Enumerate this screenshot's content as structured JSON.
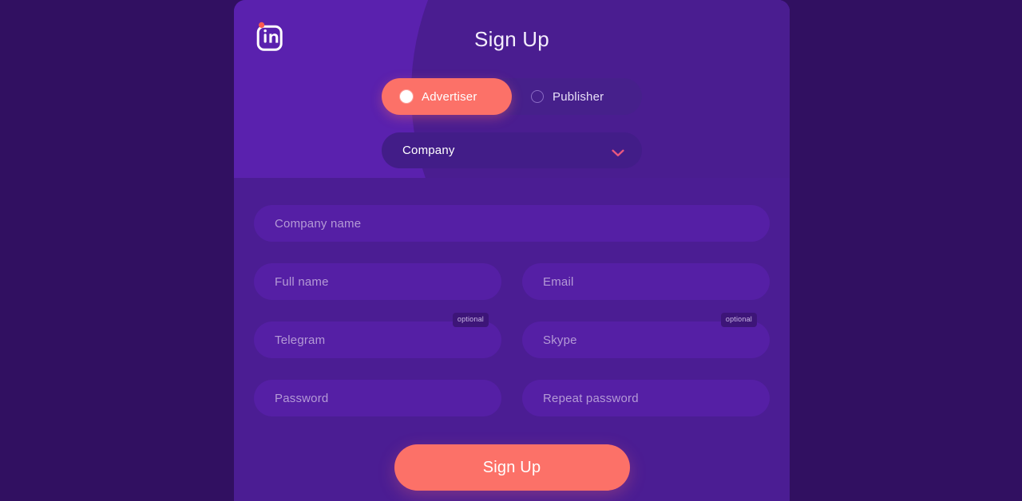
{
  "page": {
    "background_color": "#311061"
  },
  "modal": {
    "header_color": "#5a21ae",
    "body_color": "#4b1d93",
    "blob_color": "#4a1d90",
    "accent_color": "#fc7168",
    "title": "Sign Up",
    "logo": {
      "icon": "in-logo-icon",
      "mark_text": "in",
      "dot_color": "#fc5a50",
      "outline_color": "#ffffff"
    }
  },
  "role_selector": {
    "options": [
      {
        "label": "Advertiser",
        "selected": true
      },
      {
        "label": "Publisher",
        "selected": false
      }
    ],
    "selected_value": "Advertiser"
  },
  "account_type": {
    "label": "Company",
    "value": "Company",
    "chevron_icon": "chevron-down-icon",
    "chevron_color": "#e8577f"
  },
  "form": {
    "rows": [
      {
        "fields": [
          {
            "name": "company-name",
            "placeholder": "Company name",
            "value": "",
            "badge": null,
            "full_width": true
          }
        ]
      },
      {
        "fields": [
          {
            "name": "full-name",
            "placeholder": "Full name",
            "value": "",
            "badge": null
          },
          {
            "name": "email",
            "placeholder": "Email",
            "value": "",
            "badge": null
          }
        ]
      },
      {
        "fields": [
          {
            "name": "telegram",
            "placeholder": "Telegram",
            "value": "",
            "badge": "optional"
          },
          {
            "name": "skype",
            "placeholder": "Skype",
            "value": "",
            "badge": "optional"
          }
        ]
      },
      {
        "fields": [
          {
            "name": "password",
            "placeholder": "Password",
            "value": "",
            "badge": null
          },
          {
            "name": "repeat-password",
            "placeholder": "Repeat password",
            "value": "",
            "badge": null
          }
        ]
      }
    ]
  },
  "submit": {
    "label": "Sign Up"
  }
}
